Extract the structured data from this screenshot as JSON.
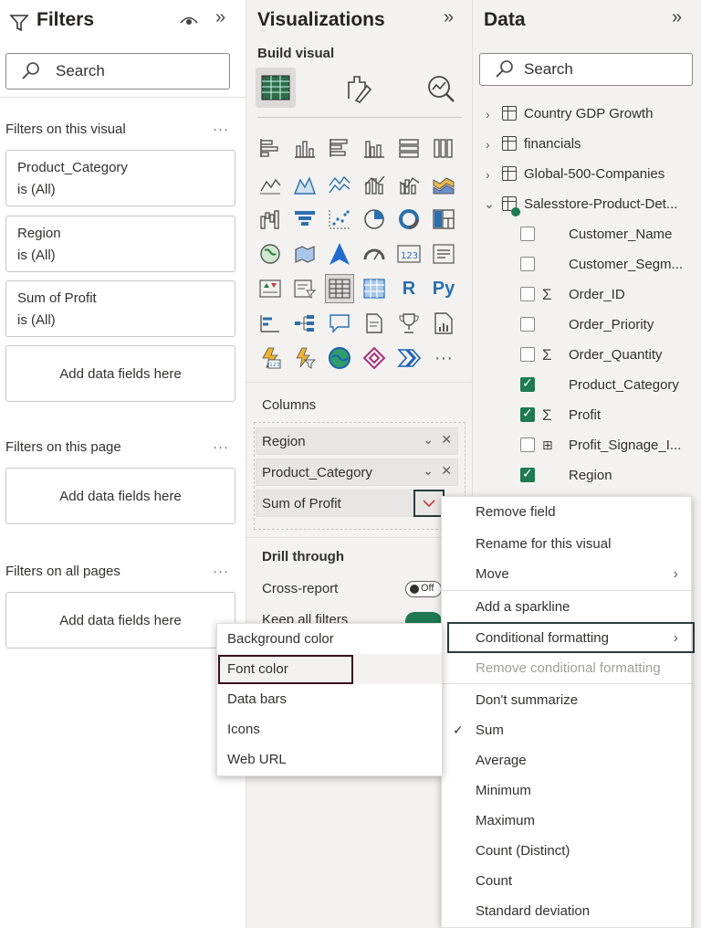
{
  "filters": {
    "title": "Filters",
    "search_placeholder": "Search",
    "visual_section": "Filters on this visual",
    "page_section": "Filters on this page",
    "all_section": "Filters on all pages",
    "more": "···",
    "cards": [
      {
        "field": "Product_Category",
        "state": "is (All)"
      },
      {
        "field": "Region",
        "state": "is (All)"
      },
      {
        "field": "Sum of Profit",
        "state": "is (All)"
      }
    ],
    "add_fields": "Add data fields here"
  },
  "visualizations": {
    "title": "Visualizations",
    "build_visual": "Build visual",
    "columns_label": "Columns",
    "wells": [
      "Region",
      "Product_Category",
      "Sum of Profit"
    ],
    "drill_through": "Drill through",
    "cross_report": "Cross-report",
    "cross_report_toggle": "Off",
    "keep_all_filters": "Keep all filters",
    "gallery_labels": {
      "r": "R",
      "py": "Py",
      "more": "···"
    }
  },
  "data": {
    "title": "Data",
    "search_placeholder": "Search",
    "tables": [
      "Country GDP Growth",
      "financials",
      "Global-500-Companies",
      "Salesstore-Product-Det..."
    ],
    "fields": [
      {
        "name": "Customer_Name",
        "checked": false,
        "sigma": false
      },
      {
        "name": "Customer_Segm...",
        "checked": false,
        "sigma": false
      },
      {
        "name": "Order_ID",
        "checked": false,
        "sigma": true
      },
      {
        "name": "Order_Priority",
        "checked": false,
        "sigma": false
      },
      {
        "name": "Order_Quantity",
        "checked": false,
        "sigma": true
      },
      {
        "name": "Product_Category",
        "checked": true,
        "sigma": false
      },
      {
        "name": "Profit",
        "checked": true,
        "sigma": true
      },
      {
        "name": "Profit_Signage_I...",
        "checked": false,
        "sigma": false
      },
      {
        "name": "Region",
        "checked": true,
        "sigma": false
      }
    ]
  },
  "context_menu": {
    "items": [
      "Remove field",
      "Rename for this visual",
      "Move",
      "Add a sparkline",
      "Conditional formatting",
      "Remove conditional formatting",
      "Don't summarize",
      "Sum",
      "Average",
      "Minimum",
      "Maximum",
      "Count (Distinct)",
      "Count",
      "Standard deviation"
    ],
    "selected_summary": "Sum"
  },
  "submenu": {
    "items": [
      "Background color",
      "Font color",
      "Data bars",
      "Icons",
      "Web URL"
    ]
  },
  "colors": {
    "accent_green": "#1f7a52",
    "highlight_box": "#2b3a3a",
    "font_color_box": "#3a1020"
  }
}
